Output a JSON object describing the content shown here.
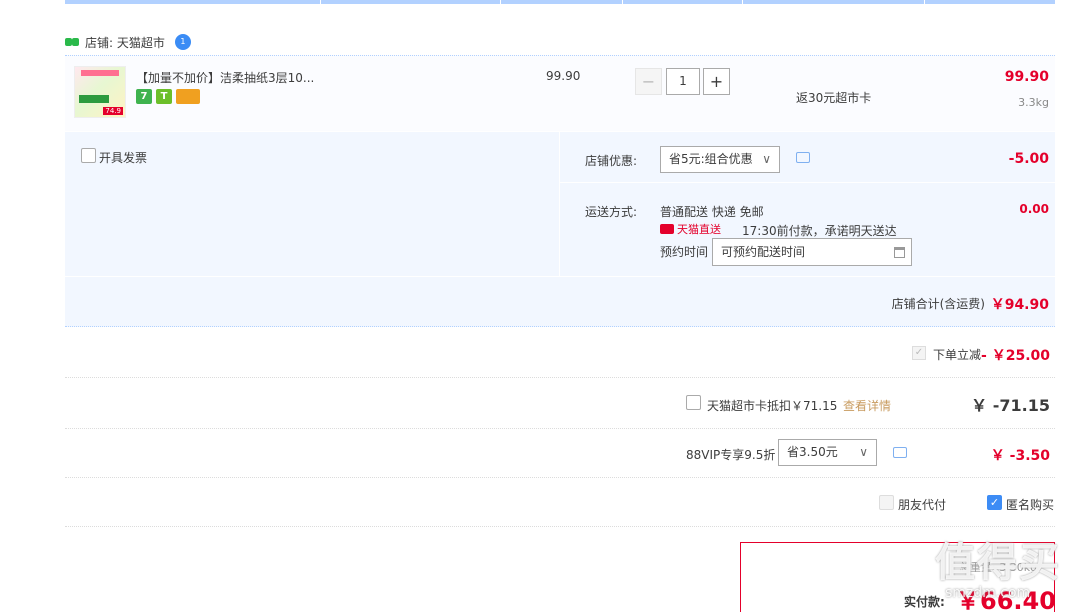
{
  "shop": {
    "label": "店铺: 天猫超市",
    "wangwang_badge": "1"
  },
  "item": {
    "title": "【加量不加价】洁柔抽纸3层10...",
    "thumb_badge": "74.9",
    "services": [
      "7",
      "T",
      ""
    ],
    "unit_price": "99.90",
    "quantity": "1",
    "promo": "返30元超市卡",
    "subtotal": "99.90",
    "weight": "3.3kg"
  },
  "options": {
    "invoice_label": "开具发票",
    "discount_label": "店铺优惠:",
    "discount_selected": "省5元:组合优惠",
    "discount_amount": "-5.00",
    "shipping_label": "运送方式:",
    "shipping_method": "普通配送 快递 免邮",
    "shipping_amount": "0.00",
    "tmall_direct": "天猫直送",
    "shipping_promise": "17:30前付款，承诺明天送达",
    "appointment_label": "预约时间",
    "appointment_placeholder": "可预约配送时间"
  },
  "shop_total": {
    "label": "店铺合计(含运费)",
    "amount": "￥94.90"
  },
  "instant_discount": {
    "label": "下单立减",
    "amount": "- ￥25.00",
    "checked": true
  },
  "supermarket_card": {
    "label": "天猫超市卡抵扣￥71.15",
    "detail_link": "查看详情",
    "amount": "￥ -71.15"
  },
  "vip": {
    "label": "88VIP专享9.5折",
    "selected": "省3.50元",
    "amount": "￥ -3.50"
  },
  "friend_pay": {
    "label": "朋友代付"
  },
  "anonymous": {
    "label": "匿名购买",
    "checked": true
  },
  "payment": {
    "weight_label": "总重量: 3.30kg",
    "label": "实付款:",
    "amount": "￥66.40"
  },
  "watermark": {
    "text": "值得买",
    "sub": "smzdm.com"
  },
  "colors": {
    "accent": "#e4002b",
    "blue_tint": "#f2f7ff",
    "link_gold": "#c89b5f",
    "check_blue": "#3d8cf5"
  }
}
